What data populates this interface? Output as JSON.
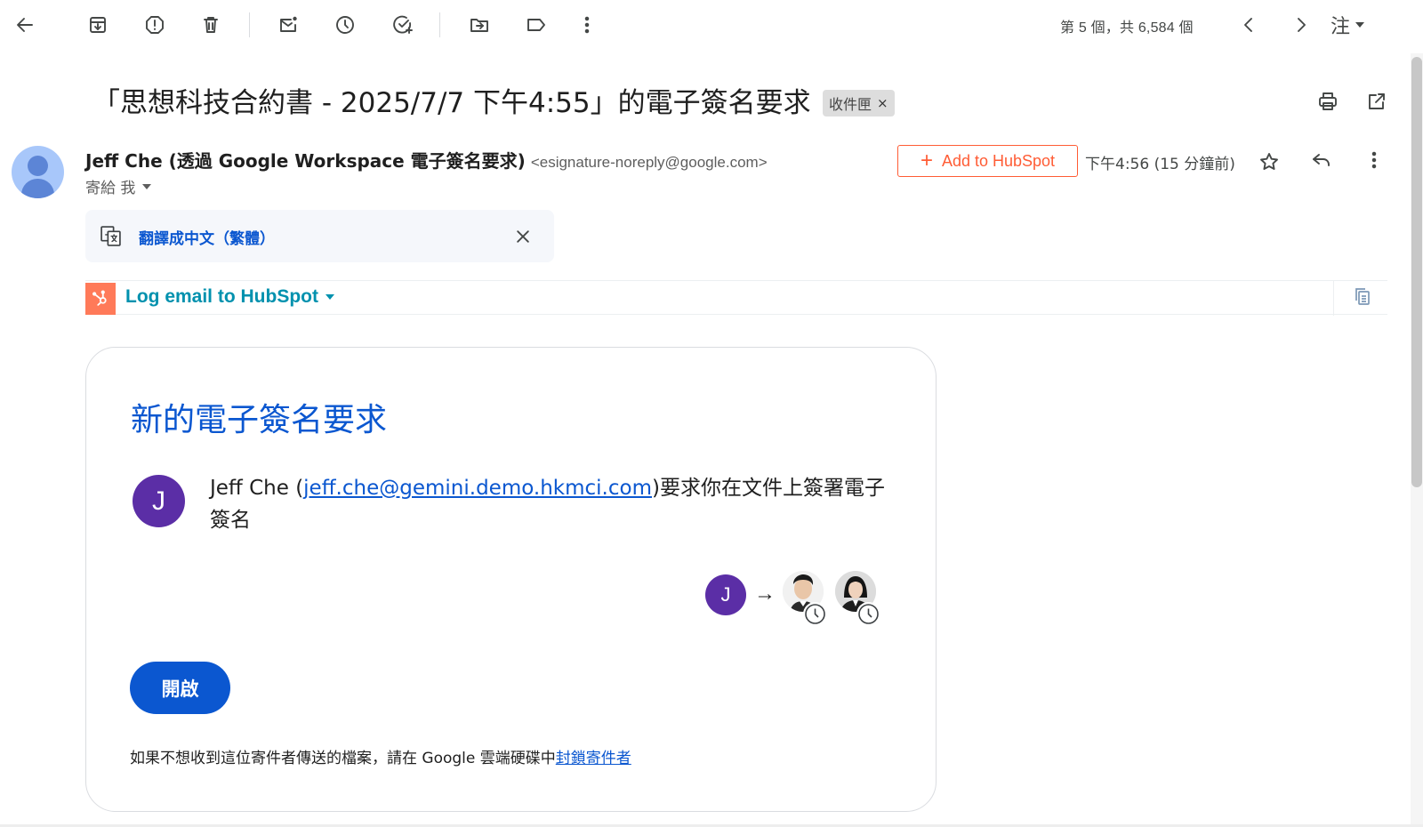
{
  "toolbar": {
    "counter": "第 5 個，共 6,584 個",
    "lang_label": "注"
  },
  "email": {
    "subject": "「思想科技合約書 - 2025/7/7 下午4:55」的電子簽名要求",
    "inbox_chip": "收件匣",
    "inbox_chip_close": "×",
    "sender_name": "Jeff Che (透過 Google Workspace 電子簽名要求)",
    "sender_email": "<esignature-noreply@google.com>",
    "to_label": "寄給 我",
    "time": "下午4:56 (15 分鐘前)"
  },
  "hubspot": {
    "add_plus": "+",
    "add_label": "Add to HubSpot",
    "log_label": "Log email to HubSpot"
  },
  "translate": {
    "label": "翻譯成中文（繁體）"
  },
  "card": {
    "title": "新的電子簽名要求",
    "avatar_letter": "J",
    "msg_prefix": "Jeff Che (",
    "msg_link": "jeff.che@gemini.demo.hkmci.com",
    "msg_suffix": ")要求你在文件上簽署電子簽名",
    "flow_letter": "J",
    "flow_arrow": "→",
    "open_label": "開啟",
    "footer_text": "如果不想收到這位寄件者傳送的檔案，請在 Google 雲端硬碟中",
    "footer_link": "封鎖寄件者"
  },
  "colors": {
    "accent_blue": "#0b57d0",
    "hubspot_orange": "#ff5c35",
    "hubspot_teal": "#0091ae",
    "avatar_purple": "#5b2ea6"
  }
}
